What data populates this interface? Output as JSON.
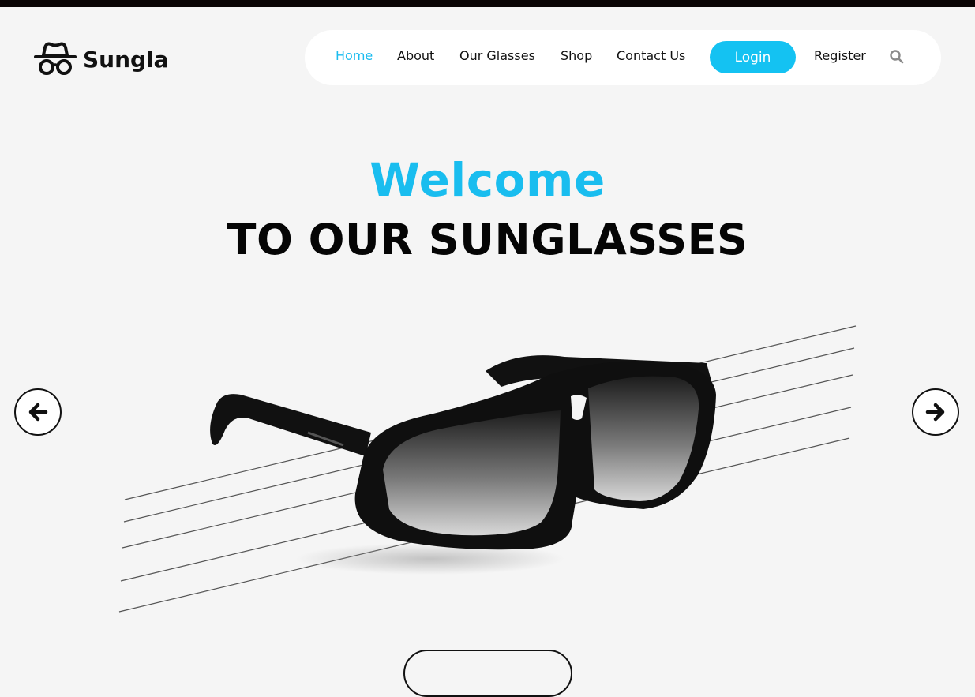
{
  "header": {
    "brand": "Sungla",
    "logo_icon": "hat-glasses-icon"
  },
  "nav": {
    "items": [
      {
        "label": "Home",
        "active": true
      },
      {
        "label": "About",
        "active": false
      },
      {
        "label": "Our Glasses",
        "active": false
      },
      {
        "label": "Shop",
        "active": false
      },
      {
        "label": "Contact Us",
        "active": false
      }
    ],
    "login_label": "Login",
    "register_label": "Register",
    "search_icon": "search-icon"
  },
  "hero": {
    "welcome": "Welcome",
    "subtitle": "TO OUR SUNGLASSES",
    "image": "sunglasses-image",
    "prev_icon": "arrow-left-icon",
    "next_icon": "arrow-right-icon"
  },
  "colors": {
    "accent": "#14c2f2",
    "background": "#f5f5f5",
    "topbar": "#0a0505"
  }
}
